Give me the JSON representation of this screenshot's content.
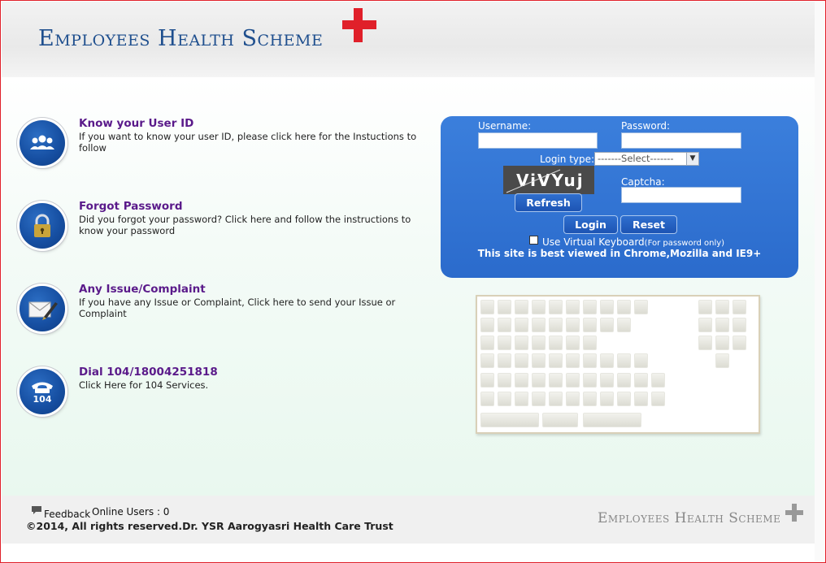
{
  "header": {
    "logo_text": "Employees Health Scheme"
  },
  "links": [
    {
      "title": "Know your User ID",
      "desc": "If you want to know your user ID, please click here for the Instuctions to follow",
      "icon": "users-icon"
    },
    {
      "title": "Forgot Password",
      "desc": "Did you forgot your password? Click here and follow the instructions to know your password",
      "icon": "padlock-icon"
    },
    {
      "title": "Any Issue/Complaint",
      "desc": "If you have any Issue or Complaint, Click here to send your Issue or Complaint",
      "icon": "mail-pen-icon"
    },
    {
      "title": "Dial 104/18004251818",
      "desc": "Click Here for 104 Services.",
      "icon": "phone-104-icon",
      "icon_text": "104"
    }
  ],
  "login": {
    "username_label": "Username:",
    "username_value": "",
    "password_label": "Password:",
    "password_value": "",
    "login_type_label": "Login type:",
    "login_type_selected": "-------Select-------",
    "captcha_label": "Captcha:",
    "captcha_value": "",
    "captcha_text": "ViVYuj",
    "refresh_label": "Refresh",
    "login_button": "Login",
    "reset_button": "Reset",
    "virtual_keyboard_label": "Use Virtual Keyboard",
    "virtual_keyboard_note": "(For password only)",
    "virtual_keyboard_checked": false,
    "best_viewed": "This site is best viewed in Chrome,Mozilla and IE9+"
  },
  "footer": {
    "feedback_label": "Feedback",
    "online_users": "Online Users : 0",
    "copyright": "©2014, All rights reserved.Dr. YSR Aarogyasri Health Care Trust",
    "logo_text": "Employees Health Scheme"
  },
  "colors": {
    "brand_blue": "#1f4f8e",
    "cross_red": "#e0202a",
    "link_title": "#5a1a8a",
    "login_panel": "#2b6bcc"
  }
}
